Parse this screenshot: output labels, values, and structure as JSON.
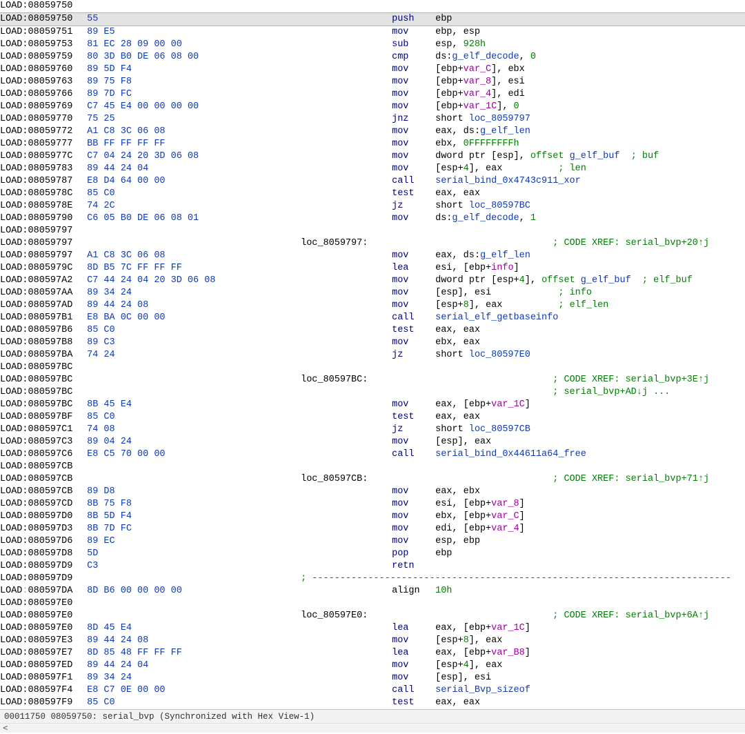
{
  "segment": "LOAD",
  "status": {
    "file_off": "00011750",
    "ea": "08059750",
    "func": "serial_bvp",
    "sync": "Synchronized with Hex View-1"
  },
  "rows": [
    {
      "addr": "08059750",
      "bytes": "",
      "kind": "blank"
    },
    {
      "addr": "08059750",
      "bytes": "55",
      "mnem": "push",
      "ops": [
        {
          "t": "plain",
          "v": "ebp"
        }
      ],
      "selected": true
    },
    {
      "addr": "08059751",
      "bytes": "89 E5",
      "mnem": "mov",
      "ops": [
        {
          "t": "plain",
          "v": "ebp"
        },
        {
          "t": "plain",
          "v": "esp"
        }
      ]
    },
    {
      "addr": "08059753",
      "bytes": "81 EC 28 09 00 00",
      "mnem": "sub",
      "ops": [
        {
          "t": "plain",
          "v": "esp"
        },
        {
          "t": "num",
          "v": "928h"
        }
      ]
    },
    {
      "addr": "08059759",
      "bytes": "80 3D B0 DE 06 08 00",
      "mnem": "cmp",
      "ops": [
        {
          "t": "plain",
          "v": "ds:"
        },
        {
          "t": "ref",
          "v": "g_elf_decode"
        },
        {
          "t": "sep",
          "v": ", "
        },
        {
          "t": "num",
          "v": "0"
        }
      ],
      "raw": true
    },
    {
      "addr": "08059760",
      "bytes": "89 5D F4",
      "mnem": "mov",
      "ops": [
        {
          "t": "plain",
          "v": "[ebp+"
        },
        {
          "t": "var",
          "v": "var_C"
        },
        {
          "t": "plain",
          "v": "]"
        },
        {
          "t": "sep",
          "v": ", "
        },
        {
          "t": "plain",
          "v": "ebx"
        }
      ],
      "raw": true
    },
    {
      "addr": "08059763",
      "bytes": "89 75 F8",
      "mnem": "mov",
      "ops": [
        {
          "t": "plain",
          "v": "[ebp+"
        },
        {
          "t": "var",
          "v": "var_8"
        },
        {
          "t": "plain",
          "v": "]"
        },
        {
          "t": "sep",
          "v": ", "
        },
        {
          "t": "plain",
          "v": "esi"
        }
      ],
      "raw": true
    },
    {
      "addr": "08059766",
      "bytes": "89 7D FC",
      "mnem": "mov",
      "ops": [
        {
          "t": "plain",
          "v": "[ebp+"
        },
        {
          "t": "var",
          "v": "var_4"
        },
        {
          "t": "plain",
          "v": "]"
        },
        {
          "t": "sep",
          "v": ", "
        },
        {
          "t": "plain",
          "v": "edi"
        }
      ],
      "raw": true
    },
    {
      "addr": "08059769",
      "bytes": "C7 45 E4 00 00 00 00",
      "mnem": "mov",
      "ops": [
        {
          "t": "plain",
          "v": "[ebp+"
        },
        {
          "t": "var",
          "v": "var_1C"
        },
        {
          "t": "plain",
          "v": "]"
        },
        {
          "t": "sep",
          "v": ", "
        },
        {
          "t": "num",
          "v": "0"
        }
      ],
      "raw": true
    },
    {
      "addr": "08059770",
      "bytes": "75 25",
      "mnem": "jnz",
      "ops": [
        {
          "t": "plain",
          "v": "short "
        },
        {
          "t": "ref",
          "v": "loc_8059797"
        }
      ],
      "raw": true
    },
    {
      "addr": "08059772",
      "bytes": "A1 C8 3C 06 08",
      "mnem": "mov",
      "ops": [
        {
          "t": "plain",
          "v": "eax"
        },
        {
          "t": "sep",
          "v": ", "
        },
        {
          "t": "plain",
          "v": "ds:"
        },
        {
          "t": "ref",
          "v": "g_elf_len"
        }
      ],
      "raw": true
    },
    {
      "addr": "08059777",
      "bytes": "BB FF FF FF FF",
      "mnem": "mov",
      "ops": [
        {
          "t": "plain",
          "v": "ebx"
        },
        {
          "t": "sep",
          "v": ", "
        },
        {
          "t": "num",
          "v": "0FFFFFFFFh"
        }
      ],
      "raw": true
    },
    {
      "addr": "0805977C",
      "bytes": "C7 04 24 20 3D 06 08",
      "mnem": "mov",
      "ops": [
        {
          "t": "plain",
          "v": "dword ptr [esp]"
        },
        {
          "t": "sep",
          "v": ", "
        },
        {
          "t": "num",
          "v": "offset "
        },
        {
          "t": "ref",
          "v": "g_elf_buf"
        }
      ],
      "cmt": " ; buf",
      "raw": true
    },
    {
      "addr": "08059783",
      "bytes": "89 44 24 04",
      "mnem": "mov",
      "ops": [
        {
          "t": "plain",
          "v": "[esp+"
        },
        {
          "t": "num",
          "v": "4"
        },
        {
          "t": "plain",
          "v": "]"
        },
        {
          "t": "sep",
          "v": ", "
        },
        {
          "t": "plain",
          "v": "eax"
        }
      ],
      "cmt": "    ; len",
      "raw": true
    },
    {
      "addr": "08059787",
      "bytes": "E8 D4 64 00 00",
      "mnem": "call",
      "ops": [
        {
          "t": "ref",
          "v": "serial_bind_0x4743c911_xor"
        }
      ],
      "raw": true
    },
    {
      "addr": "0805978C",
      "bytes": "85 C0",
      "mnem": "test",
      "ops": [
        {
          "t": "plain",
          "v": "eax"
        },
        {
          "t": "plain",
          "v": "eax"
        }
      ]
    },
    {
      "addr": "0805978E",
      "bytes": "74 2C",
      "mnem": "jz",
      "ops": [
        {
          "t": "plain",
          "v": "short "
        },
        {
          "t": "ref",
          "v": "loc_80597BC"
        }
      ],
      "raw": true
    },
    {
      "addr": "08059790",
      "bytes": "C6 05 B0 DE 06 08 01",
      "mnem": "mov",
      "ops": [
        {
          "t": "plain",
          "v": "ds:"
        },
        {
          "t": "ref",
          "v": "g_elf_decode"
        },
        {
          "t": "sep",
          "v": ", "
        },
        {
          "t": "num",
          "v": "1"
        }
      ],
      "raw": true
    },
    {
      "addr": "08059797",
      "bytes": "",
      "kind": "blank"
    },
    {
      "addr": "08059797",
      "bytes": "",
      "kind": "label",
      "label": "loc_8059797:",
      "xref": "; CODE XREF: serial_bvp+20↑j"
    },
    {
      "addr": "08059797",
      "bytes": "A1 C8 3C 06 08",
      "mnem": "mov",
      "ops": [
        {
          "t": "plain",
          "v": "eax"
        },
        {
          "t": "sep",
          "v": ", "
        },
        {
          "t": "plain",
          "v": "ds:"
        },
        {
          "t": "ref",
          "v": "g_elf_len"
        }
      ],
      "raw": true
    },
    {
      "addr": "0805979C",
      "bytes": "8D B5 7C FF FF FF",
      "mnem": "lea",
      "ops": [
        {
          "t": "plain",
          "v": "esi"
        },
        {
          "t": "sep",
          "v": ", "
        },
        {
          "t": "plain",
          "v": "[ebp+"
        },
        {
          "t": "var",
          "v": "info"
        },
        {
          "t": "plain",
          "v": "]"
        }
      ],
      "raw": true
    },
    {
      "addr": "080597A2",
      "bytes": "C7 44 24 04 20 3D 06 08",
      "mnem": "mov",
      "ops": [
        {
          "t": "plain",
          "v": "dword ptr [esp+"
        },
        {
          "t": "num",
          "v": "4"
        },
        {
          "t": "plain",
          "v": "]"
        },
        {
          "t": "sep",
          "v": ", "
        },
        {
          "t": "num",
          "v": "offset "
        },
        {
          "t": "ref",
          "v": "g_elf_buf"
        }
      ],
      "cmt": " ; elf_buf",
      "raw": true
    },
    {
      "addr": "080597AA",
      "bytes": "89 34 24",
      "mnem": "mov",
      "ops": [
        {
          "t": "plain",
          "v": "[esp]"
        },
        {
          "t": "sep",
          "v": ", "
        },
        {
          "t": "plain",
          "v": "esi"
        }
      ],
      "cmt": "    ; info",
      "raw": true
    },
    {
      "addr": "080597AD",
      "bytes": "89 44 24 08",
      "mnem": "mov",
      "ops": [
        {
          "t": "plain",
          "v": "[esp+"
        },
        {
          "t": "num",
          "v": "8"
        },
        {
          "t": "plain",
          "v": "]"
        },
        {
          "t": "sep",
          "v": ", "
        },
        {
          "t": "plain",
          "v": "eax"
        }
      ],
      "cmt": "    ; elf_len",
      "raw": true
    },
    {
      "addr": "080597B1",
      "bytes": "E8 BA 0C 00 00",
      "mnem": "call",
      "ops": [
        {
          "t": "ref",
          "v": "serial_elf_getbaseinfo"
        }
      ],
      "raw": true
    },
    {
      "addr": "080597B6",
      "bytes": "85 C0",
      "mnem": "test",
      "ops": [
        {
          "t": "plain",
          "v": "eax"
        },
        {
          "t": "plain",
          "v": "eax"
        }
      ]
    },
    {
      "addr": "080597B8",
      "bytes": "89 C3",
      "mnem": "mov",
      "ops": [
        {
          "t": "plain",
          "v": "ebx"
        },
        {
          "t": "plain",
          "v": "eax"
        }
      ]
    },
    {
      "addr": "080597BA",
      "bytes": "74 24",
      "mnem": "jz",
      "ops": [
        {
          "t": "plain",
          "v": "short "
        },
        {
          "t": "ref",
          "v": "loc_80597E0"
        }
      ],
      "raw": true
    },
    {
      "addr": "080597BC",
      "bytes": "",
      "kind": "blank"
    },
    {
      "addr": "080597BC",
      "bytes": "",
      "kind": "label",
      "label": "loc_80597BC:",
      "xref": "; CODE XREF: serial_bvp+3E↑j"
    },
    {
      "addr": "080597BC",
      "bytes": "",
      "kind": "xrefcont",
      "xref": "; serial_bvp+AD↓j ..."
    },
    {
      "addr": "080597BC",
      "bytes": "8B 45 E4",
      "mnem": "mov",
      "ops": [
        {
          "t": "plain",
          "v": "eax"
        },
        {
          "t": "sep",
          "v": ", "
        },
        {
          "t": "plain",
          "v": "[ebp+"
        },
        {
          "t": "var",
          "v": "var_1C"
        },
        {
          "t": "plain",
          "v": "]"
        }
      ],
      "raw": true
    },
    {
      "addr": "080597BF",
      "bytes": "85 C0",
      "mnem": "test",
      "ops": [
        {
          "t": "plain",
          "v": "eax"
        },
        {
          "t": "plain",
          "v": "eax"
        }
      ]
    },
    {
      "addr": "080597C1",
      "bytes": "74 08",
      "mnem": "jz",
      "ops": [
        {
          "t": "plain",
          "v": "short "
        },
        {
          "t": "ref",
          "v": "loc_80597CB"
        }
      ],
      "raw": true
    },
    {
      "addr": "080597C3",
      "bytes": "89 04 24",
      "mnem": "mov",
      "ops": [
        {
          "t": "plain",
          "v": "[esp]"
        },
        {
          "t": "sep",
          "v": ", "
        },
        {
          "t": "plain",
          "v": "eax"
        }
      ],
      "raw": true
    },
    {
      "addr": "080597C6",
      "bytes": "E8 C5 70 00 00",
      "mnem": "call",
      "ops": [
        {
          "t": "ref",
          "v": "serial_bind_0x44611a64_free"
        }
      ],
      "raw": true
    },
    {
      "addr": "080597CB",
      "bytes": "",
      "kind": "blank"
    },
    {
      "addr": "080597CB",
      "bytes": "",
      "kind": "label",
      "label": "loc_80597CB:",
      "xref": "; CODE XREF: serial_bvp+71↑j"
    },
    {
      "addr": "080597CB",
      "bytes": "89 D8",
      "mnem": "mov",
      "ops": [
        {
          "t": "plain",
          "v": "eax"
        },
        {
          "t": "plain",
          "v": "ebx"
        }
      ]
    },
    {
      "addr": "080597CD",
      "bytes": "8B 75 F8",
      "mnem": "mov",
      "ops": [
        {
          "t": "plain",
          "v": "esi"
        },
        {
          "t": "sep",
          "v": ", "
        },
        {
          "t": "plain",
          "v": "[ebp+"
        },
        {
          "t": "var",
          "v": "var_8"
        },
        {
          "t": "plain",
          "v": "]"
        }
      ],
      "raw": true
    },
    {
      "addr": "080597D0",
      "bytes": "8B 5D F4",
      "mnem": "mov",
      "ops": [
        {
          "t": "plain",
          "v": "ebx"
        },
        {
          "t": "sep",
          "v": ", "
        },
        {
          "t": "plain",
          "v": "[ebp+"
        },
        {
          "t": "var",
          "v": "var_C"
        },
        {
          "t": "plain",
          "v": "]"
        }
      ],
      "raw": true
    },
    {
      "addr": "080597D3",
      "bytes": "8B 7D FC",
      "mnem": "mov",
      "ops": [
        {
          "t": "plain",
          "v": "edi"
        },
        {
          "t": "sep",
          "v": ", "
        },
        {
          "t": "plain",
          "v": "[ebp+"
        },
        {
          "t": "var",
          "v": "var_4"
        },
        {
          "t": "plain",
          "v": "]"
        }
      ],
      "raw": true
    },
    {
      "addr": "080597D6",
      "bytes": "89 EC",
      "mnem": "mov",
      "ops": [
        {
          "t": "plain",
          "v": "esp"
        },
        {
          "t": "plain",
          "v": "ebp"
        }
      ]
    },
    {
      "addr": "080597D8",
      "bytes": "5D",
      "mnem": "pop",
      "ops": [
        {
          "t": "plain",
          "v": "ebp"
        }
      ]
    },
    {
      "addr": "080597D9",
      "bytes": "C3",
      "mnem": "retn",
      "ops": []
    },
    {
      "addr": "080597D9",
      "bytes": "",
      "kind": "sep"
    },
    {
      "addr": "080597DA",
      "bytes": "8D B6 00 00 00 00",
      "mnem": "align",
      "mnem_plain": true,
      "ops": [
        {
          "t": "num",
          "v": "10h"
        }
      ],
      "muted": true,
      "raw": true
    },
    {
      "addr": "080597E0",
      "bytes": "",
      "kind": "blank"
    },
    {
      "addr": "080597E0",
      "bytes": "",
      "kind": "label",
      "label": "loc_80597E0:",
      "xref": "; CODE XREF: serial_bvp+6A↑j"
    },
    {
      "addr": "080597E0",
      "bytes": "8D 45 E4",
      "mnem": "lea",
      "ops": [
        {
          "t": "plain",
          "v": "eax"
        },
        {
          "t": "sep",
          "v": ", "
        },
        {
          "t": "plain",
          "v": "[ebp+"
        },
        {
          "t": "var",
          "v": "var_1C"
        },
        {
          "t": "plain",
          "v": "]"
        }
      ],
      "raw": true
    },
    {
      "addr": "080597E3",
      "bytes": "89 44 24 08",
      "mnem": "mov",
      "ops": [
        {
          "t": "plain",
          "v": "[esp+"
        },
        {
          "t": "num",
          "v": "8"
        },
        {
          "t": "plain",
          "v": "]"
        },
        {
          "t": "sep",
          "v": ", "
        },
        {
          "t": "plain",
          "v": "eax"
        }
      ],
      "raw": true
    },
    {
      "addr": "080597E7",
      "bytes": "8D 85 48 FF FF FF",
      "mnem": "lea",
      "ops": [
        {
          "t": "plain",
          "v": "eax"
        },
        {
          "t": "sep",
          "v": ", "
        },
        {
          "t": "plain",
          "v": "[ebp+"
        },
        {
          "t": "var",
          "v": "var_B8"
        },
        {
          "t": "plain",
          "v": "]"
        }
      ],
      "raw": true
    },
    {
      "addr": "080597ED",
      "bytes": "89 44 24 04",
      "mnem": "mov",
      "ops": [
        {
          "t": "plain",
          "v": "[esp+"
        },
        {
          "t": "num",
          "v": "4"
        },
        {
          "t": "plain",
          "v": "]"
        },
        {
          "t": "sep",
          "v": ", "
        },
        {
          "t": "plain",
          "v": "eax"
        }
      ],
      "raw": true
    },
    {
      "addr": "080597F1",
      "bytes": "89 34 24",
      "mnem": "mov",
      "ops": [
        {
          "t": "plain",
          "v": "[esp]"
        },
        {
          "t": "sep",
          "v": ", "
        },
        {
          "t": "plain",
          "v": "esi"
        }
      ],
      "raw": true
    },
    {
      "addr": "080597F4",
      "bytes": "E8 C7 0E 00 00",
      "mnem": "call",
      "ops": [
        {
          "t": "ref",
          "v": "serial_Bvp_sizeof"
        }
      ],
      "raw": true
    },
    {
      "addr": "080597F9",
      "bytes": "85 C0",
      "mnem": "test",
      "ops": [
        {
          "t": "plain",
          "v": "eax"
        },
        {
          "t": "plain",
          "v": "eax"
        }
      ]
    }
  ]
}
